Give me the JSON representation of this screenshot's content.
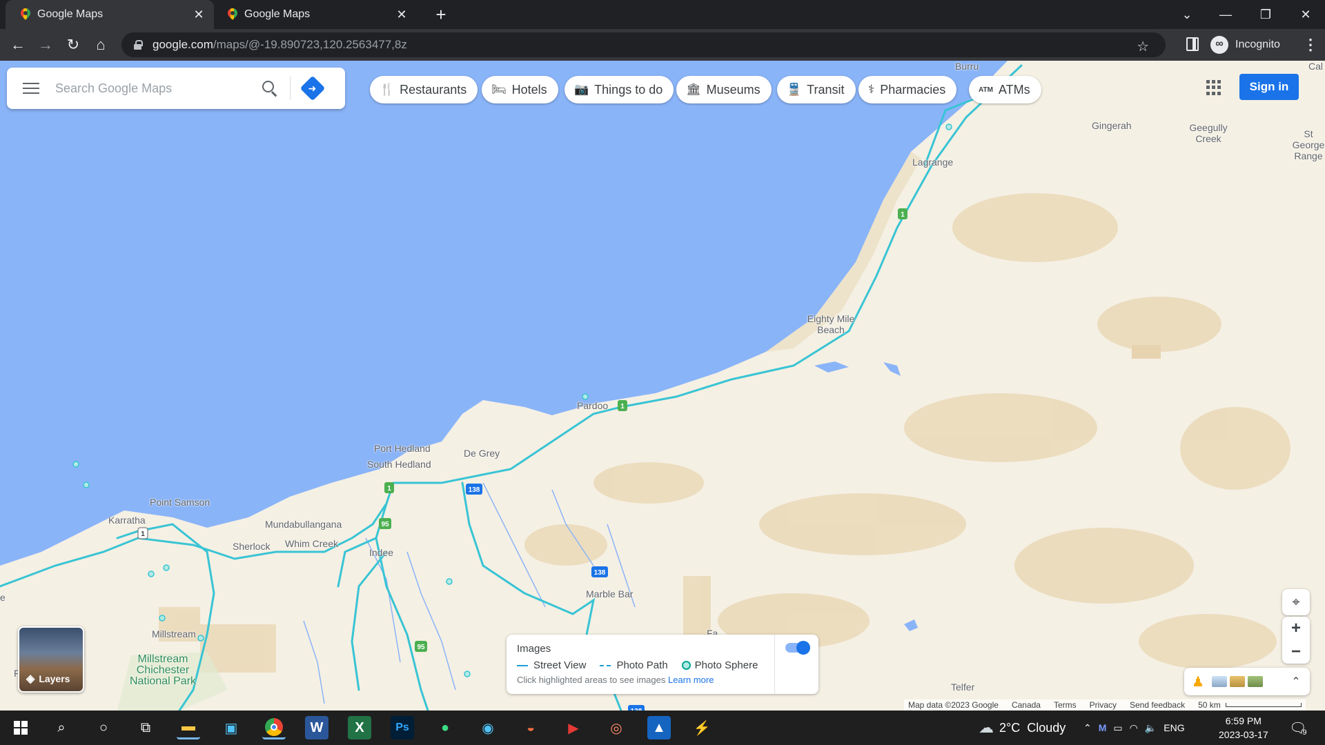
{
  "browser": {
    "tabs": [
      {
        "title": "Google Maps",
        "close": "✕"
      },
      {
        "title": "Google Maps",
        "close": "✕"
      }
    ],
    "new_tab": "+",
    "url_host": "google.com",
    "url_path": "/maps/@-19.890723,120.2563477,8z",
    "incognito_label": "Incognito",
    "window_controls": {
      "dropdown": "⌄",
      "minimize": "—",
      "restore": "❐",
      "close": "✕"
    },
    "nav": {
      "back": "←",
      "forward": "→",
      "reload": "↻",
      "home": "⌂",
      "star": "☆",
      "menu": "⋮"
    }
  },
  "maps": {
    "search_placeholder": "Search Google Maps",
    "chips": [
      {
        "icon": "fork-knife-icon",
        "glyph": "🍴",
        "label": "Restaurants"
      },
      {
        "icon": "bed-icon",
        "glyph": "🛏",
        "label": "Hotels"
      },
      {
        "icon": "camera-icon",
        "glyph": "📷",
        "label": "Things to do"
      },
      {
        "icon": "museum-icon",
        "glyph": "🏛",
        "label": "Museums"
      },
      {
        "icon": "train-icon",
        "glyph": "🚆",
        "label": "Transit"
      },
      {
        "icon": "pharmacy-icon",
        "glyph": "⚕",
        "label": "Pharmacies"
      },
      {
        "icon": "atm-icon",
        "glyph": "ATM",
        "label": "ATMs"
      }
    ],
    "sign_in": "Sign in",
    "layers_label": "Layers",
    "places": [
      {
        "name": "Burru"
      },
      {
        "name": "Cal"
      },
      {
        "name": "Gingerah"
      },
      {
        "name": "Geegully Creek"
      },
      {
        "name": "St George Range"
      },
      {
        "name": "Lagrange"
      },
      {
        "name": "Eighty Mile Beach"
      },
      {
        "name": "Pardoo"
      },
      {
        "name": "Port Hedland"
      },
      {
        "name": "South Hedland"
      },
      {
        "name": "De Grey"
      },
      {
        "name": "Point Samson"
      },
      {
        "name": "Karratha"
      },
      {
        "name": "Mundabullangana"
      },
      {
        "name": "Sherlock"
      },
      {
        "name": "Whim Creek"
      },
      {
        "name": "Indee"
      },
      {
        "name": "Marble Bar"
      },
      {
        "name": "Millstream"
      },
      {
        "name": "Millstream Chichester National Park"
      },
      {
        "name": "Telfer"
      },
      {
        "name": "e"
      },
      {
        "name": "F"
      },
      {
        "name": "Fa"
      }
    ],
    "road_shields": [
      "1",
      "1",
      "1",
      "1",
      "95",
      "95",
      "138",
      "138",
      "138"
    ],
    "images_card": {
      "title": "Images",
      "street_view": "Street View",
      "photo_path": "Photo Path",
      "photo_sphere": "Photo Sphere",
      "hint": "Click highlighted areas to see images",
      "learn_more": "Learn more",
      "toggle_on": true
    },
    "zoom_in": "+",
    "zoom_out": "−",
    "attribution": {
      "map_data": "Map data ©2023 Google",
      "country": "Canada",
      "terms": "Terms",
      "privacy": "Privacy",
      "feedback": "Send feedback",
      "scale": "50 km"
    },
    "colors": {
      "water": "#8ab4f8",
      "land": "#f5f0e4",
      "road": "#38c4d4",
      "desert": "#ead9b8",
      "park": "#c8e6c9",
      "accent": "#1a73e8"
    }
  },
  "taskbar": {
    "weather": "2°C  Cloudy",
    "language": "ENG",
    "time": "6:59 PM",
    "date": "2023-03-17",
    "notifications": "9",
    "apps": [
      "start-icon",
      "search-icon",
      "cortana-icon",
      "task-view-icon",
      "file-explorer-icon",
      "outlook-icon",
      "chrome-icon",
      "word-icon",
      "excel-icon",
      "photoshop-icon",
      "android-icon",
      "mu-icon",
      "app-icon",
      "video-icon",
      "media-icon",
      "photos-icon",
      "flash-icon"
    ]
  }
}
